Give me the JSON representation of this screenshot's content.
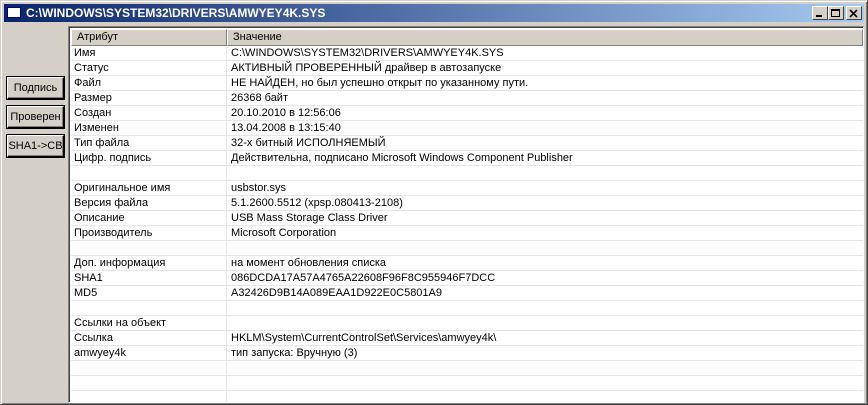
{
  "window": {
    "title": "C:\\WINDOWS\\SYSTEM32\\DRIVERS\\AMWYEY4K.SYS",
    "titlebar_color": "#0a246a"
  },
  "left_buttons": {
    "sign": "Подпись",
    "check": "Проверен",
    "sha1": "SHA1->CB"
  },
  "table": {
    "headers": {
      "attr": "Атрибут",
      "value": "Значение"
    },
    "rows": [
      {
        "attr": "Имя",
        "value": "C:\\WINDOWS\\SYSTEM32\\DRIVERS\\AMWYEY4K.SYS"
      },
      {
        "attr": "Статус",
        "value": "АКТИВНЫЙ ПРОВЕРЕННЫЙ драйвер в автозапуске"
      },
      {
        "attr": "Файл",
        "value": "НЕ НАЙДЕН, но был успешно открыт по указанному пути."
      },
      {
        "attr": "Размер",
        "value": "26368 байт"
      },
      {
        "attr": "Создан",
        "value": "20.10.2010 в 12:56:06"
      },
      {
        "attr": "Изменен",
        "value": "13.04.2008 в 13:15:40"
      },
      {
        "attr": "Тип файла",
        "value": "32-х битный ИСПОЛНЯЕМЫЙ"
      },
      {
        "attr": "Цифр. подпись",
        "value": "Действительна, подписано Microsoft Windows Component Publisher"
      },
      {
        "attr": "",
        "value": ""
      },
      {
        "attr": "Оригинальное имя",
        "value": "usbstor.sys"
      },
      {
        "attr": "Версия файла",
        "value": "5.1.2600.5512 (xpsp.080413-2108)"
      },
      {
        "attr": "Описание",
        "value": "USB Mass Storage Class Driver"
      },
      {
        "attr": "Производитель",
        "value": "Microsoft Corporation"
      },
      {
        "attr": "",
        "value": ""
      },
      {
        "attr": "Доп. информация",
        "value": "на момент обновления списка"
      },
      {
        "attr": "SHA1",
        "value": "086DCDA17A57A4765A22608F96F8C955946F7DCC"
      },
      {
        "attr": "MD5",
        "value": "A32426D9B14A089EAA1D922E0C5801A9"
      },
      {
        "attr": "",
        "value": ""
      },
      {
        "attr": "Ссылки на объект",
        "value": ""
      },
      {
        "attr": "Ссылка",
        "value": "HKLM\\System\\CurrentControlSet\\Services\\amwyey4k\\"
      },
      {
        "attr": "amwyey4k",
        "value": "тип запуска: Вручную (3)"
      },
      {
        "attr": "",
        "value": ""
      },
      {
        "attr": "",
        "value": ""
      },
      {
        "attr": "",
        "value": ""
      },
      {
        "attr": "",
        "value": ""
      }
    ]
  }
}
